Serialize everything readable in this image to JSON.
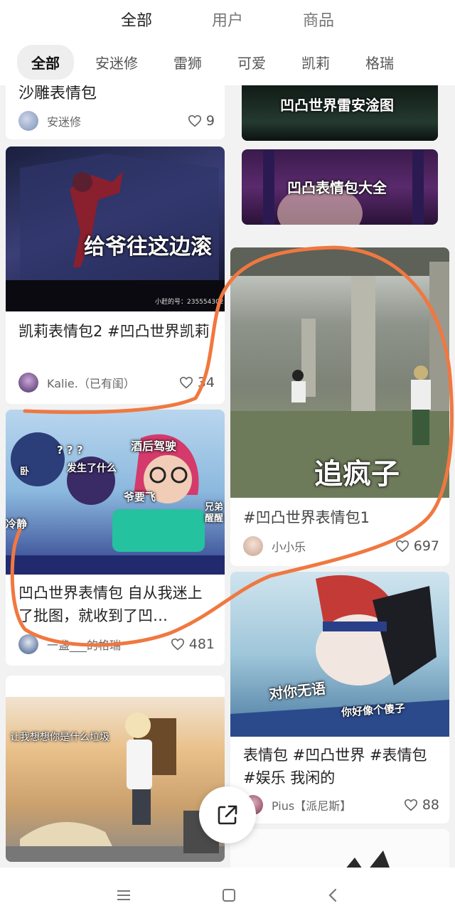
{
  "top_tabs": [
    {
      "label": "全部"
    },
    {
      "label": "用户"
    },
    {
      "label": "商品"
    }
  ],
  "chips": [
    {
      "label": "全部"
    },
    {
      "label": "安迷修"
    },
    {
      "label": "雷狮"
    },
    {
      "label": "可爱"
    },
    {
      "label": "凯莉"
    },
    {
      "label": "格瑞"
    }
  ],
  "left_cards": [
    {
      "title": "沙雕表情包",
      "author": "安迷修",
      "likes": "9"
    },
    {
      "image_text": "给爷往这边滚",
      "watermark": "小赶的号：235554302",
      "title": "凯莉表情包2 #凹凸世界凯莉",
      "author": "Kalie.（已有闺）",
      "likes": "34"
    },
    {
      "image_texts": [
        "? ? ?",
        "发生了什么",
        "酒后驾驶",
        "卧",
        "爷要飞",
        "冷静",
        "兄弟醒醒"
      ],
      "title": "凹凸世界表情包 自从我迷上了批图，就收到了凹…",
      "author": "一盏___的格瑞",
      "likes": "481"
    },
    {
      "image_text": "让我想想你是什么垃圾"
    }
  ],
  "right_cards": [
    {
      "image_text": "凹凸世界雷安淦图"
    },
    {
      "image_text": "凹凸表情包大全"
    },
    {
      "image_text": "追疯子",
      "title": "#凹凸世界表情包1",
      "author": "小小乐",
      "likes": "697"
    },
    {
      "image_texts": [
        "对你无语",
        "你好像个傻子"
      ],
      "title": "表情包 #凹凸世界 #表情包 #娱乐 我闲的",
      "author": "Pius【派尼斯】",
      "likes": "88"
    }
  ],
  "colors": {
    "accent": "#e0252b",
    "annotation": "#f07840"
  }
}
